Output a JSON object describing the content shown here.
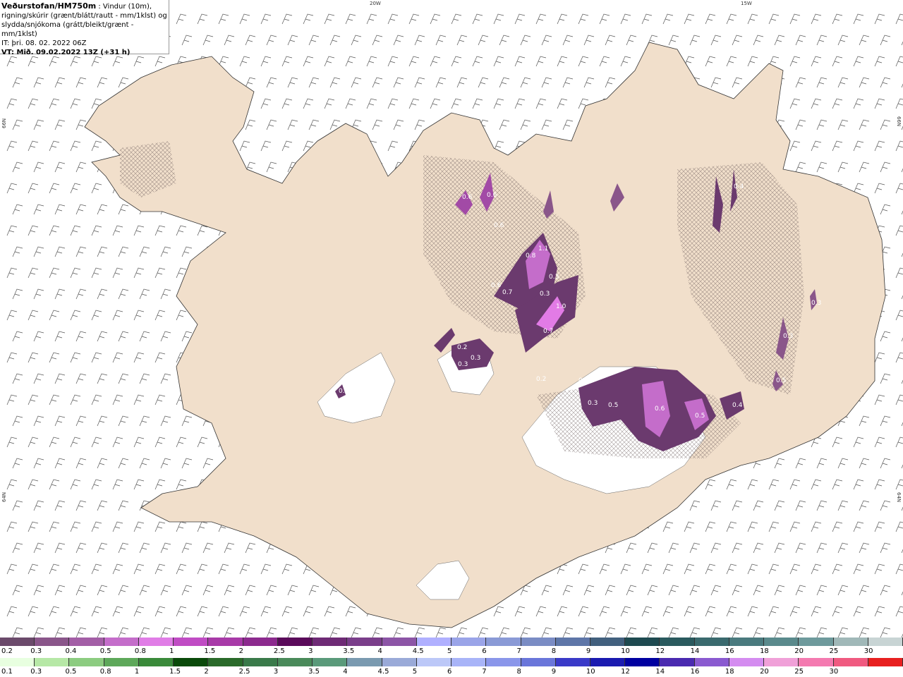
{
  "header": {
    "source": "Veðurstofan/HM750m",
    "line1_rest": " : Vindur (10m),",
    "line2": "rigning/skúrir (grænt/blátt/rautt - mm/1klst) og",
    "line3": "slydda/snjókoma (grátt/bleikt/grænt - mm/1klst)",
    "line4": "IT: þri. 08. 02. 2022 06Z",
    "line5": "VT: Mið. 09.02.2022 13Z (+31 h)"
  },
  "coordinates": {
    "lon_20w": "20W",
    "lon_15w": "15W",
    "lat_66n_left": "66N",
    "lat_66n_right": "66N",
    "lat_64n_left": "64N",
    "lat_64n_right": "64N"
  },
  "colors": {
    "land": "#f1dfcb",
    "roads": "#e8703a",
    "snow_light": "#ffffff",
    "precip_dark": "#6b3a6e",
    "precip_mid": "#a24aa6",
    "precip_bright": "#e27be6"
  },
  "precip_labels": [
    "0.6",
    "0.6",
    "0.6",
    "0.8",
    "1.1",
    "0.3",
    "0.6",
    "0.7",
    "0.3",
    "1.0",
    "0.7",
    "0.2",
    "0.3",
    "0.3",
    "0.5",
    "0.2",
    "0.3",
    "0.3",
    "0.5",
    "0.6",
    "0.5",
    "0.4",
    "0.4",
    "0.3",
    "0.5",
    "0.3"
  ],
  "snow_scale": {
    "colors": [
      "#6b4a6b",
      "#8a568a",
      "#a35ea6",
      "#c46dca",
      "#e07de6",
      "#c04cc4",
      "#a83aa8",
      "#8c2a8e",
      "#5a0a5a",
      "#6e2a75",
      "#7a3e8a",
      "#8c55a6",
      "#b0b0ff",
      "#9aa4e8",
      "#8a9ad6",
      "#7a8cc4",
      "#5e76a8",
      "#42607e",
      "#1e4a50",
      "#2a5a5e",
      "#3a6a6e",
      "#4a7a7e",
      "#5a8a8c",
      "#6e9a9c",
      "#a0b8b8",
      "#c8d4d4"
    ],
    "labels": [
      "0.2",
      "0.3",
      "0.4",
      "0.5",
      "0.8",
      "1",
      "1.5",
      "2",
      "2.5",
      "3",
      "3.5",
      "4",
      "4.5",
      "5",
      "6",
      "7",
      "8",
      "9",
      "10",
      "12",
      "14",
      "16",
      "18",
      "20",
      "25",
      "30"
    ]
  },
  "rain_scale": {
    "colors": [
      "#e8ffe0",
      "#b6e8a6",
      "#8ccc80",
      "#5ea85a",
      "#3a8a3a",
      "#0a4a0a",
      "#2a6a2a",
      "#3a7a4a",
      "#4a8a5a",
      "#5a9a7a",
      "#7a9ab0",
      "#9aaad8",
      "#bcc8f8",
      "#a8b4f8",
      "#8a96ea",
      "#6a76da",
      "#3a3ac8",
      "#1a1ab0",
      "#0000a0",
      "#4a2ab0",
      "#8a5ad0",
      "#d48cf0",
      "#f0a0d8",
      "#f47ab0",
      "#f05a80",
      "#e82020"
    ],
    "labels": [
      "0.1",
      "0.3",
      "0.5",
      "0.8",
      "1",
      "1.5",
      "2",
      "2.5",
      "3",
      "3.5",
      "4",
      "4.5",
      "5",
      "6",
      "7",
      "8",
      "9",
      "10",
      "12",
      "14",
      "16",
      "18",
      "20",
      "25",
      "30"
    ]
  }
}
